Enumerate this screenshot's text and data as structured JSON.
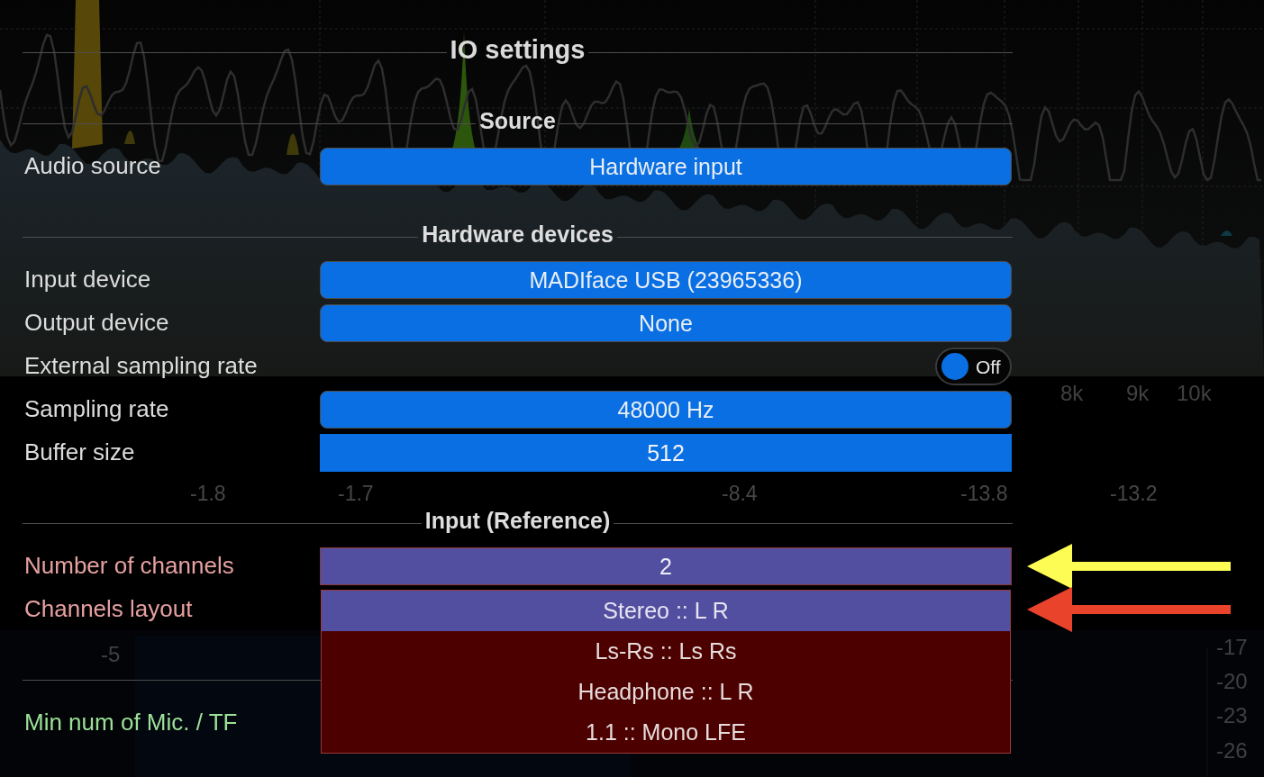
{
  "background": {
    "frequency_labels": [
      "8k",
      "9k",
      "10k"
    ],
    "readouts": [
      "-1.8",
      "-1.7",
      "-8.4",
      "-13.8",
      "-13.2"
    ],
    "left_scale": [
      "-5"
    ],
    "right_scale": [
      "-17",
      "-20",
      "-23",
      "-26"
    ]
  },
  "dialog": {
    "title": "IO settings"
  },
  "sections": [
    {
      "heading": "Source",
      "rows": [
        {
          "kind": "select",
          "label": "Audio source",
          "color": "#dcdcdc",
          "value": "Hardware input"
        }
      ]
    },
    {
      "heading": "Hardware devices",
      "rows": [
        {
          "kind": "select",
          "label": "Input device",
          "color": "#dcdcdc",
          "value": "MADIface USB (23965336)"
        },
        {
          "kind": "select",
          "label": "Output device",
          "color": "#dcdcdc",
          "value": "None"
        },
        {
          "kind": "toggle",
          "label": "External sampling rate",
          "color": "#dcdcdc",
          "on": false,
          "value": "Off"
        },
        {
          "kind": "select",
          "label": "Sampling rate",
          "color": "#dcdcdc",
          "value": "48000 Hz"
        },
        {
          "kind": "entry",
          "label": "Buffer size",
          "color": "#dcdcdc",
          "focused": false,
          "value": "512"
        }
      ]
    },
    {
      "heading": "Input (Reference)",
      "rows": [
        {
          "kind": "entry",
          "label": "Number of channels",
          "color": "#e6a0a0",
          "focused": true,
          "value": "2",
          "arrow": {
            "color": "#fdfc55"
          }
        },
        {
          "kind": "dropdown",
          "label": "Channels layout",
          "color": "#e6a0a0",
          "expanded": true,
          "options": [
            {
              "label": "Stereo :: L R",
              "selected": true
            },
            {
              "label": "Ls-Rs :: Ls Rs",
              "selected": false
            },
            {
              "label": "Headphone :: L R",
              "selected": false
            },
            {
              "label": "1.1 :: Mono LFE",
              "selected": false
            }
          ],
          "arrow": {
            "color": "#e9442b"
          }
        }
      ]
    },
    {
      "rows": [
        {
          "kind": "label",
          "label": "Min num of Mic. / TF",
          "color": "#9ce098"
        }
      ]
    }
  ]
}
